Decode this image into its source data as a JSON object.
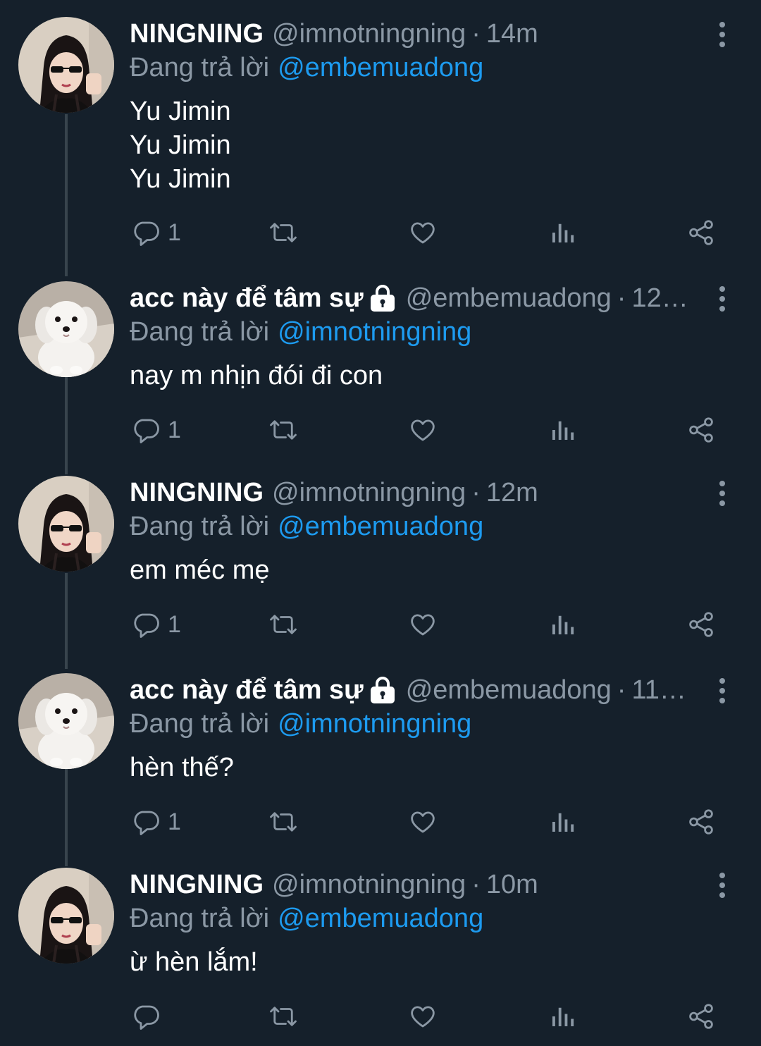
{
  "reply_prefix": "Đang trả lời",
  "tweets": [
    {
      "name": "NINGNING",
      "handle": "@imnotningning",
      "separator": "·",
      "time": "14m",
      "reply_to": "@embemuadong",
      "body": "Yu Jimin\nYu Jimin\nYu Jimin",
      "reply_count": "1",
      "avatar": "girl-sunglasses-avatar",
      "locked": false
    },
    {
      "name": "acc này để tâm sự",
      "handle": "@embemuadong",
      "separator": "·",
      "time": "12…",
      "reply_to": "@imnotningning",
      "body": "nay m nhịn đói đi con",
      "reply_count": "1",
      "avatar": "white-puppy-avatar",
      "locked": true
    },
    {
      "name": "NINGNING",
      "handle": "@imnotningning",
      "separator": "·",
      "time": "12m",
      "reply_to": "@embemuadong",
      "body": "em méc mẹ",
      "reply_count": "1",
      "avatar": "girl-sunglasses-avatar",
      "locked": false
    },
    {
      "name": "acc này để tâm sự",
      "handle": "@embemuadong",
      "separator": "·",
      "time": "11…",
      "reply_to": "@imnotningning",
      "body": "hèn thế?",
      "reply_count": "1",
      "avatar": "white-puppy-avatar",
      "locked": true
    },
    {
      "name": "NINGNING",
      "handle": "@imnotningning",
      "separator": "·",
      "time": "10m",
      "reply_to": "@embemuadong",
      "body": "ừ hèn lắm!",
      "reply_count": "",
      "avatar": "girl-sunglasses-avatar",
      "locked": false
    }
  ],
  "colors": {
    "background": "#15202b",
    "secondary_text": "#8b98a5",
    "mention": "#1d9bf0",
    "thread_line": "#38444d"
  }
}
